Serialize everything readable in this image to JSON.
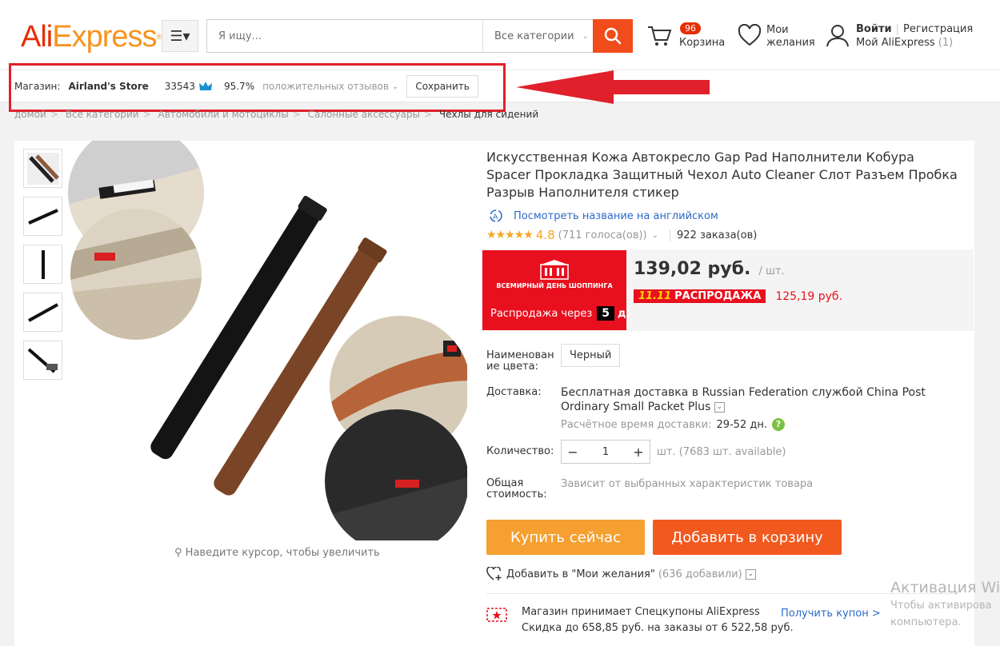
{
  "header": {
    "logo_text": "AliExpress",
    "logo_mark": "®",
    "search_placeholder": "Я ищу...",
    "category_select": "Все категории",
    "cart_count": "96",
    "cart_label": "Корзина",
    "wishlist_label": "Мои желания",
    "login_label": "Войти",
    "register_label": "Регистрация",
    "my_account_label": "Мой AliExpress",
    "my_account_count": "(1)"
  },
  "store_bar": {
    "store_label": "Магазин:",
    "store_name": "Airland's Store",
    "feedback_score": "33543",
    "positive_percent": "95.7%",
    "positive_label": "положительных отзывов",
    "save_button": "Сохранить"
  },
  "breadcrumb": [
    "домой",
    "Все категории",
    "Автомобили и мотоциклы",
    "Салонные аксессуары",
    "Чехлы для сидений"
  ],
  "gallery": {
    "zoom_hint": "Наведите курсор, чтобы увеличить",
    "thumbnail_count": 5
  },
  "product": {
    "title": "Искусственная Кожа Автокресло Gap Pad Наполнители Кобура Spacer Прокладка Защитный Чехол Auto Cleaner Слот Разъем Пробка Разрыв Наполнителя стикер",
    "translate_link": "Посмотреть название на английском",
    "rating_score": "4.8",
    "rating_votes": "(711 голоса(ов))",
    "orders": "922 заказа(ов)",
    "stars": 4.8
  },
  "promo": {
    "badge_title": "ВСЕМИРНЫЙ ДЕНЬ ШОППИНГА",
    "badge_logo": "11.11",
    "countdown_label": "Распродажа через",
    "countdown_value": "5",
    "countdown_unit": "д."
  },
  "price": {
    "main": "139,02 руб.",
    "per_unit": "/ шт.",
    "sale_tag": "РАСПРОДАЖА",
    "sale_tag_prefix": "11.11",
    "sale_price": "125,19 руб."
  },
  "options": {
    "color_label": "Наименован ие цвета:",
    "color_value": "Черный",
    "shipping_label": "Доставка:",
    "shipping_free": "Бесплатная доставка в",
    "shipping_country": "Russian Federation",
    "shipping_via": "службой",
    "shipping_method": "China Post Ordinary Small Packet Plus",
    "eta_label": "Расчётное время доставки:",
    "eta_days": "29-52 дн.",
    "quantity_label": "Количество:",
    "quantity_value": "1",
    "available": "шт. (7683 шт. available)",
    "total_label": "Общая стоимость:",
    "total_value": "Зависит от выбранных характеристик товара"
  },
  "actions": {
    "buy_now": "Купить сейчас",
    "add_to_cart": "Добавить в корзину",
    "add_wishlist": "Добавить в \"Мои желания\"",
    "wishlist_count": "(636 добавили)"
  },
  "coupon": {
    "line1": "Магазин принимает Спецкупоны AliExpress",
    "line2": "Скидка до 658,85 руб. на заказы от 6 522,58 руб.",
    "link": "Получить купон >"
  },
  "watermark": {
    "line1": "Активация Wi",
    "line2": "Чтобы активирова",
    "line3": "компьютера."
  },
  "colors": {
    "accent": "#f04c1c",
    "sale_red": "#e8101e",
    "buy_orange": "#f5a030",
    "cart_orange": "#f1591f",
    "link_blue": "#2b6bc7",
    "annotation_red": "#e0202b"
  }
}
